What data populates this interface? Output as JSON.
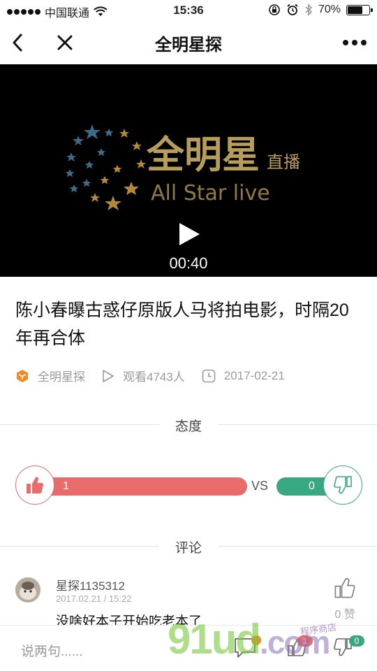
{
  "status_bar": {
    "carrier": "中国联通",
    "time": "15:36",
    "battery": "70%"
  },
  "nav": {
    "title": "全明星探"
  },
  "video": {
    "duration": "00:40",
    "logo_cn": "全明星",
    "logo_sub_cn": "直播",
    "logo_en": "All Star live"
  },
  "article": {
    "headline": "陈小春曝古惑仔原版人马将拍电影，时隔20年再合体",
    "source": "全明星探",
    "views": "观看4743人",
    "date": "2017-02-21"
  },
  "attitude": {
    "title": "态度",
    "up_count": "1",
    "vs": "VS",
    "down_count": "0",
    "up_fraction": 1.0
  },
  "comments_section": {
    "title": "评论",
    "items": [
      {
        "author": "星探1135312",
        "time": "2017.02.21 / 15:22",
        "text": "没啥好本子开始吃老本了",
        "likes": "0 赞"
      }
    ]
  },
  "bottom_bar": {
    "placeholder": "说两句......",
    "comment_badge": "",
    "like_badge": "1",
    "dislike_badge": "0"
  },
  "watermark": {
    "main": "91ud",
    "suffix": ".com",
    "tag": "程序商店"
  },
  "colors": {
    "up": "#e96b6b",
    "down": "#38a882",
    "source_icon": "#f08a24"
  }
}
